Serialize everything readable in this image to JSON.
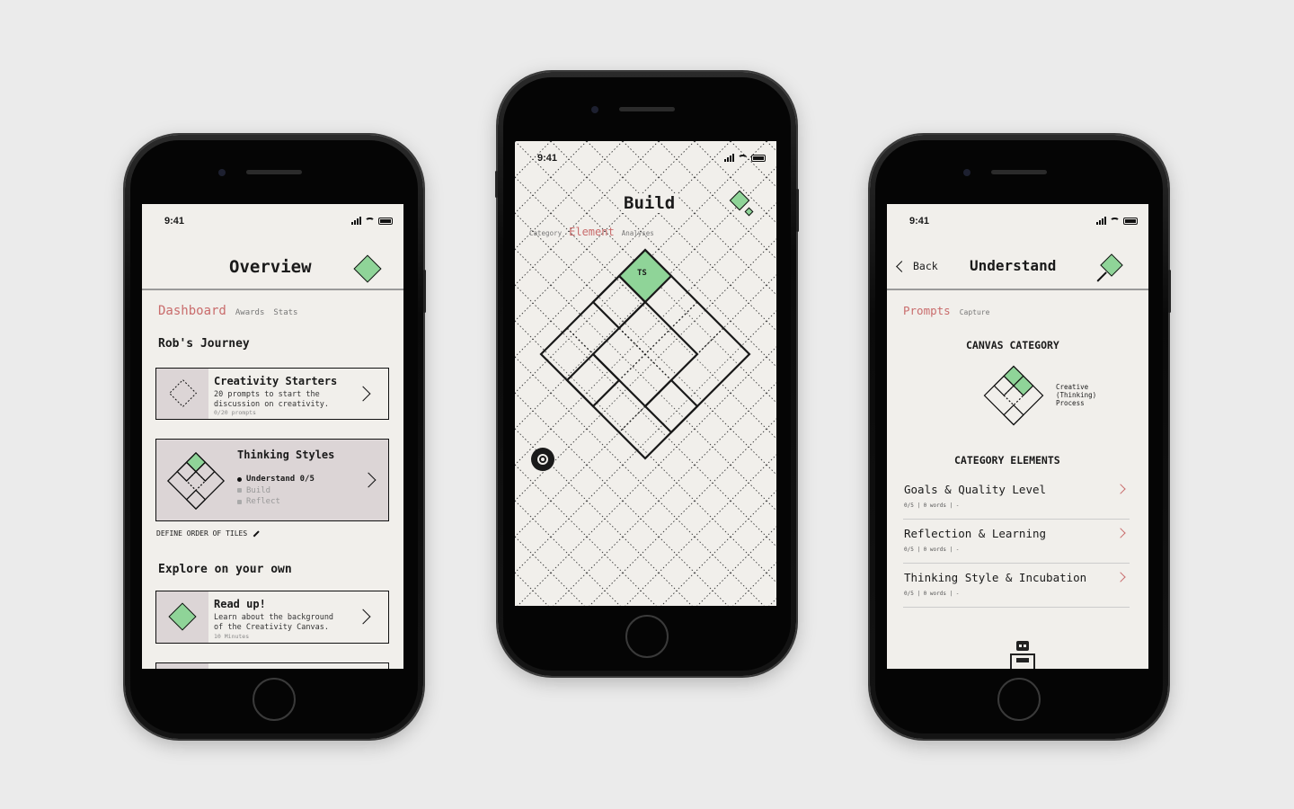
{
  "status": {
    "time": "9:41"
  },
  "overview": {
    "title": "Overview",
    "tabs": {
      "active": "Dashboard",
      "awards": "Awards",
      "stats": "Stats"
    },
    "journey_heading": "Rob's Journey",
    "creativity_card": {
      "title": "Creativity Starters",
      "desc": "20 prompts to start the discussion on creativity.",
      "meta": "0/20 prompts"
    },
    "thinking_card": {
      "title": "Thinking Styles",
      "steps": [
        "Understand 0/5",
        "Build",
        "Reflect"
      ]
    },
    "define_order": "DEFINE ORDER OF TILES",
    "explore_heading": "Explore on your own",
    "read_card": {
      "title": "Read up!",
      "desc": "Learn about the background of the Creativity Canvas.",
      "meta": "10 Minutes"
    }
  },
  "build": {
    "title": "Build",
    "tabs": {
      "category": "Category",
      "element": "Element",
      "analyses": "Analyses"
    },
    "tile_label": "TS"
  },
  "understand": {
    "back_label": "Back",
    "title": "Understand",
    "tabs": {
      "active": "Prompts",
      "capture": "Capture"
    },
    "canvas_category_heading": "CANVAS CATEGORY",
    "category_caption": "Creative (Thinking) Process",
    "category_elements_heading": "CATEGORY ELEMENTS",
    "elements": [
      {
        "label": "Goals & Quality Level",
        "meta": "0/5 | 0 words | -"
      },
      {
        "label": "Reflection & Learning",
        "meta": "0/5 | 0 words | -"
      },
      {
        "label": "Thinking Style & Incubation",
        "meta": "0/5 | 0 words | -"
      }
    ]
  },
  "colors": {
    "accent_red": "#c96c6c",
    "accent_green": "#8fd498",
    "screen_bg": "#f1efeb",
    "tile_bg": "#dcd5d6"
  }
}
